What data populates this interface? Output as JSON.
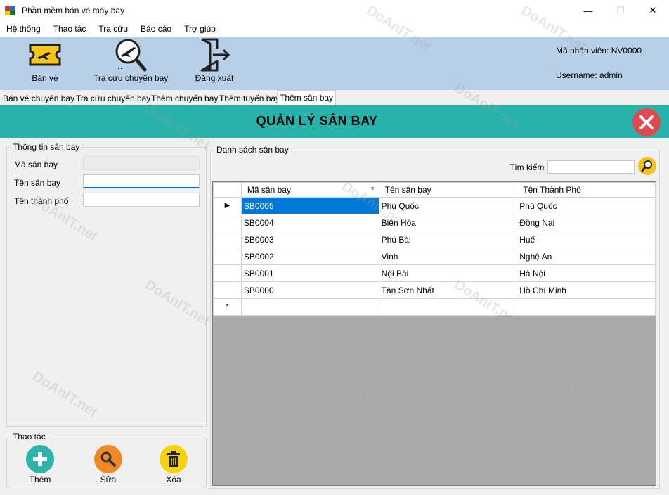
{
  "window": {
    "title": "Phần mềm bán vé máy bay"
  },
  "menu": [
    "Hệ thống",
    "Thao tác",
    "Tra cứu",
    "Báo cáo",
    "Trợ giúp"
  ],
  "toolbar": {
    "buttons": [
      {
        "label": "Bán vé",
        "icon": "ticket-icon"
      },
      {
        "label": "Tra cứu chuyến bay",
        "icon": "search-flight-icon"
      },
      {
        "label": "Đăng xuất",
        "icon": "logout-icon"
      }
    ],
    "employee": "Mã nhân viên: NV0000",
    "username": "Username: admin"
  },
  "tabs": [
    "Bán vé chuyến bay",
    "Tra cứu chuyến bay",
    "Thêm chuyến bay",
    "Thêm tuyến bay",
    "Thêm sân bay"
  ],
  "banner": {
    "title": "QUẢN LÝ SÂN BAY"
  },
  "info": {
    "legend": "Thông tin sân bay",
    "ma_label": "Mã sân bay",
    "ten_label": "Tên sân bay",
    "thanhpho_label": "Tên thành phố",
    "ma_value": "",
    "ten_value": "",
    "thanhpho_value": ""
  },
  "actions": {
    "legend": "Thao tác",
    "add": "Thêm",
    "edit": "Sửa",
    "delete": "Xóa"
  },
  "list": {
    "legend": "Danh sách sân bay",
    "search_label": "Tìm kiếm",
    "search_value": "",
    "columns": [
      "Mã sân bay",
      "Tên sân bay",
      "Tên Thành Phố"
    ],
    "rows": [
      [
        "SB0005",
        "Phú Quốc",
        "Phú Quốc"
      ],
      [
        "SB0004",
        "Biên Hòa",
        "Đồng Nai"
      ],
      [
        "SB0003",
        "Phú Bài",
        "Huế"
      ],
      [
        "SB0002",
        "Vinh",
        "Nghệ An"
      ],
      [
        "SB0001",
        "Nội Bài",
        "Hà Nội"
      ],
      [
        "SB0000",
        "Tân Sơn Nhất",
        "Hồ Chí Minh"
      ]
    ],
    "current_row_marker": "▶",
    "new_row_marker": "*"
  },
  "watermark": "DoAnIT.net",
  "colors": {
    "toolbar": "#b8cfe8",
    "banner": "#27b2aa",
    "selection": "#0078d7",
    "close": "#e04a4f"
  }
}
